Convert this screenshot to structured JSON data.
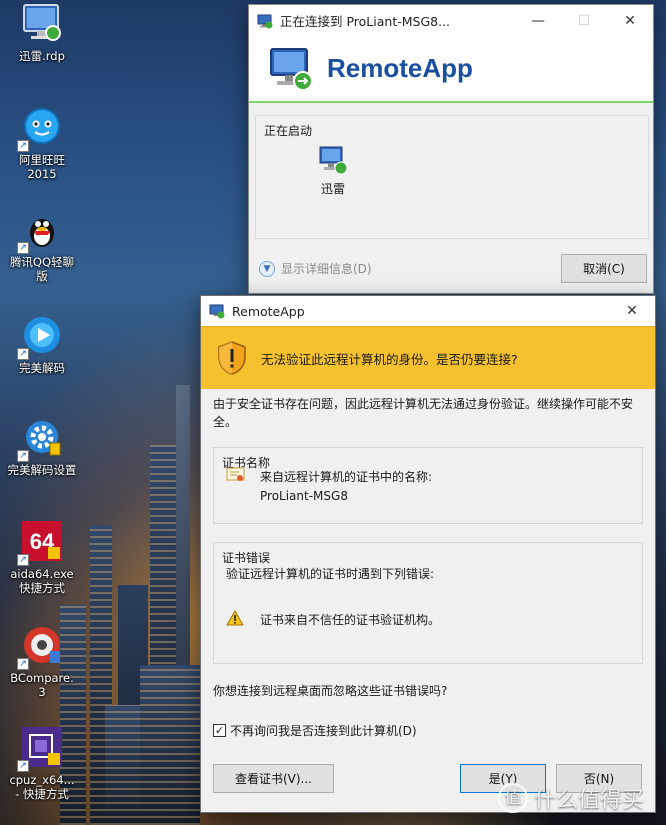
{
  "desktop": {
    "icons": [
      {
        "label": "迅雷.rdp",
        "icon": "rdp-file-icon"
      },
      {
        "label": "阿里旺旺\n2015",
        "icon": "aliwangwang-icon"
      },
      {
        "label": "腾讯QQ轻聊\n版",
        "icon": "qq-icon"
      },
      {
        "label": "完美解码",
        "icon": "potplayer-icon"
      },
      {
        "label": "完美解码设置",
        "icon": "settings-gear-icon"
      },
      {
        "label": "aida64.exe\n快捷方式",
        "icon": "aida64-icon"
      },
      {
        "label": "BCompare.\n3",
        "icon": "bcompare-icon"
      },
      {
        "label": "cpuz_x64...\n- 快捷方式",
        "icon": "cpuz-icon"
      }
    ]
  },
  "progress_window": {
    "title": "正在连接到 ProLiant-MSG8...",
    "header": "RemoteApp",
    "group_title": "正在启动",
    "app_label": "迅雷",
    "details_toggle": "显示详细信息(D)",
    "cancel_label": "取消(C)"
  },
  "cert_dialog": {
    "title": "RemoteApp",
    "headline": "无法验证此远程计算机的身份。是否仍要连接?",
    "intro": "由于安全证书存在问题，因此远程计算机无法通过身份验证。继续操作可能不安全。",
    "cert_name_group": "证书名称",
    "cert_name_line": "来自远程计算机的证书中的名称:",
    "cert_name_value": "ProLiant-MSG8",
    "cert_error_group": "证书错误",
    "cert_error_line": "验证远程计算机的证书时遇到下列错误:",
    "cert_error_item": "证书来自不信任的证书验证机构。",
    "question": "你想连接到远程桌面而忽略这些证书错误吗?",
    "checkbox_label": "不再询问我是否连接到此计算机(D)",
    "checkbox_checked": true,
    "view_cert_label": "查看证书(V)...",
    "yes_label": "是(Y)",
    "no_label": "否(N)"
  },
  "watermark": {
    "text": "什么值得买",
    "mark": "值"
  },
  "colors": {
    "remoteapp_blue": "#1a4fa0",
    "warning_banner": "#f5c12f",
    "progress_green": "#7fd36b"
  }
}
